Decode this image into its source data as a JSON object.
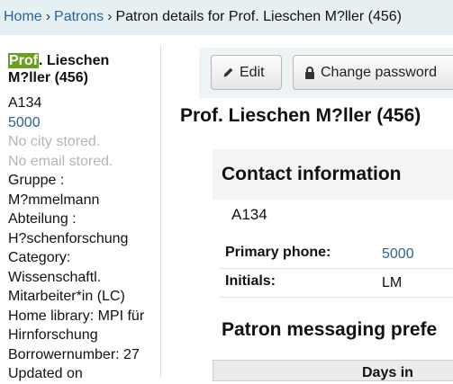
{
  "breadcrumb": {
    "home": "Home",
    "patrons": "Patrons",
    "current": "Patron details for Prof. Lieschen M?ller (456)",
    "separator": "›"
  },
  "sidebar": {
    "name_highlight": "Prof",
    "name_rest_line1": ". Lieschen",
    "name_line2": "M?ller (456)",
    "lines": [
      {
        "text": "A134",
        "style": "plain"
      },
      {
        "text": "5000",
        "style": "link"
      },
      {
        "text": "No city stored.",
        "style": "muted"
      },
      {
        "text": "No email stored.",
        "style": "muted"
      },
      {
        "text": "Gruppe :",
        "style": "plain"
      },
      {
        "text": "M?mmelmann",
        "style": "plain"
      },
      {
        "text": "Abteilung :",
        "style": "plain"
      },
      {
        "text": "H?schenforschung",
        "style": "plain"
      },
      {
        "text": "Category:",
        "style": "plain"
      },
      {
        "text": "Wissenschaftl.",
        "style": "plain"
      },
      {
        "text": "Mitarbeiter*in (LC)",
        "style": "plain"
      },
      {
        "text": "Home library: MPI für",
        "style": "plain"
      },
      {
        "text": "Hirnforschung",
        "style": "plain"
      },
      {
        "text": "Borrowernumber: 27",
        "style": "plain"
      },
      {
        "text": "Updated on",
        "style": "plain"
      }
    ]
  },
  "toolbar": {
    "edit_label": "Edit",
    "change_password_label": "Change password",
    "edit_icon": "pencil-icon",
    "lock_icon": "lock-icon"
  },
  "main": {
    "title": "Prof. Lieschen M?ller (456)",
    "contact_heading": "Contact information",
    "address": "A134",
    "fields": [
      {
        "label": "Primary phone:",
        "value": "5000",
        "is_link": true
      },
      {
        "label": "Initials:",
        "value": "LM",
        "is_link": false
      }
    ],
    "messaging_heading": "Patron messaging prefe",
    "table_header": "Days in"
  },
  "colors": {
    "link": "#2a6496",
    "breadcrumb_bg": "#e6f0f2",
    "highlight": "#6a9e1f",
    "muted": "#b5b5b5"
  }
}
